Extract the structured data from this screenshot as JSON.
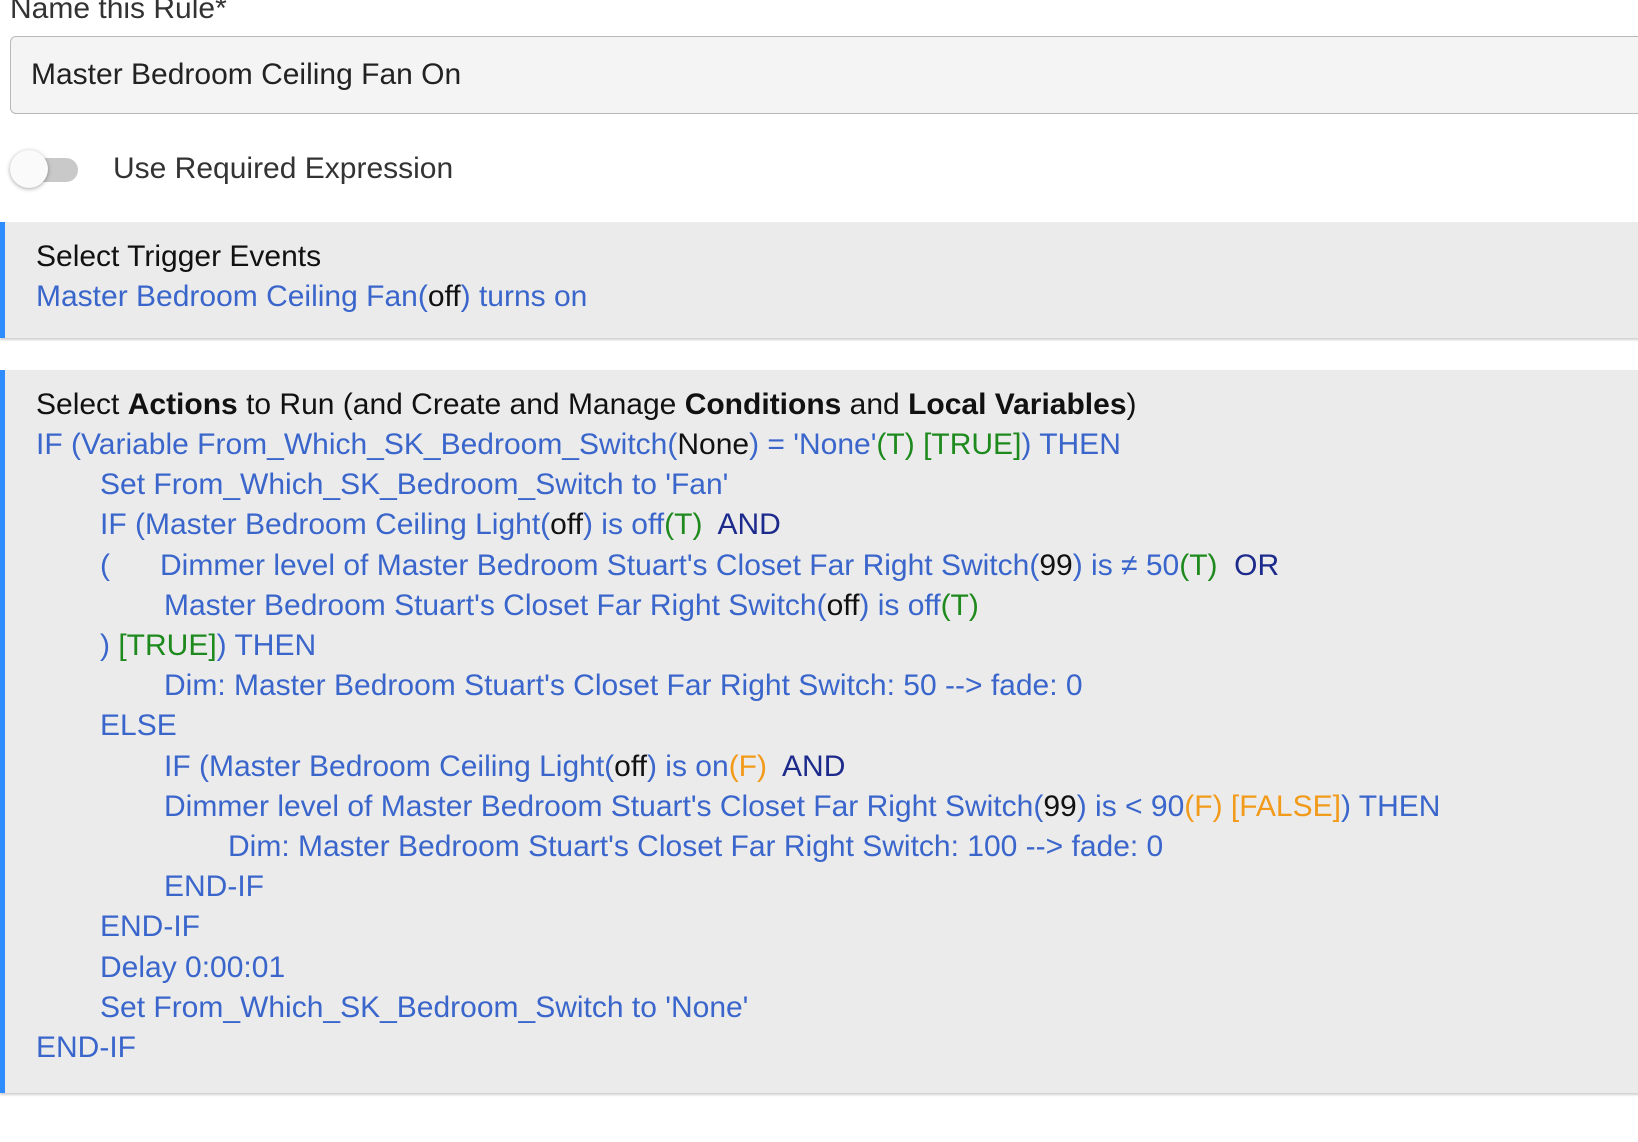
{
  "name_field": {
    "label": "Name this Rule*",
    "value": "Master Bedroom Ceiling Fan On"
  },
  "required_expression": {
    "label": "Use Required Expression",
    "enabled": false
  },
  "trigger": {
    "title": "Select Trigger Events",
    "device": "Master Bedroom Ceiling Fan",
    "paren_open": "(",
    "state": "off",
    "paren_close_text": ") turns on"
  },
  "actions": {
    "title_parts": [
      "Select ",
      "Actions",
      " to Run (and Create and Manage ",
      "Conditions",
      " and ",
      "Local Variables",
      ")"
    ],
    "lines": [
      {
        "indent": 0,
        "segments": [
          {
            "c": "blu",
            "t": "IF (Variable From_Which_SK_Bedroom_Switch("
          },
          {
            "c": "blk",
            "t": "None"
          },
          {
            "c": "blu",
            "t": ") = 'None'"
          },
          {
            "c": "grn",
            "t": "(T) [TRUE]"
          },
          {
            "c": "blu",
            "t": ") THEN"
          }
        ]
      },
      {
        "indent": 1,
        "segments": [
          {
            "c": "blu",
            "t": "Set From_Which_SK_Bedroom_Switch to 'Fan'"
          }
        ]
      },
      {
        "indent": 1,
        "segments": [
          {
            "c": "blu",
            "t": "IF (Master Bedroom Ceiling Light("
          },
          {
            "c": "blk",
            "t": "off"
          },
          {
            "c": "blu",
            "t": ") is off"
          },
          {
            "c": "grn",
            "t": "(T)"
          },
          {
            "c": "nav",
            "t": "  AND"
          }
        ]
      },
      {
        "indent": 1,
        "segments": [
          {
            "c": "blu",
            "t": "(      Dimmer level of Master Bedroom Stuart's Closet Far Right Switch("
          },
          {
            "c": "blk",
            "t": "99"
          },
          {
            "c": "blu",
            "t": ") is ≠ 50"
          },
          {
            "c": "grn",
            "t": "(T)"
          },
          {
            "c": "nav",
            "t": "  OR"
          }
        ]
      },
      {
        "indent": 2,
        "segments": [
          {
            "c": "blu",
            "t": "Master Bedroom Stuart's Closet Far Right Switch("
          },
          {
            "c": "blk",
            "t": "off"
          },
          {
            "c": "blu",
            "t": ") is off"
          },
          {
            "c": "grn",
            "t": "(T)"
          }
        ]
      },
      {
        "indent": 1,
        "segments": [
          {
            "c": "blu",
            "t": ") "
          },
          {
            "c": "grn",
            "t": "[TRUE]"
          },
          {
            "c": "blu",
            "t": ") THEN"
          }
        ]
      },
      {
        "indent": 2,
        "segments": [
          {
            "c": "blu",
            "t": "Dim: Master Bedroom Stuart's Closet Far Right Switch: 50 --> fade: 0"
          }
        ]
      },
      {
        "indent": 1,
        "segments": [
          {
            "c": "blu",
            "t": "ELSE"
          }
        ]
      },
      {
        "indent": 2,
        "segments": [
          {
            "c": "blu",
            "t": "IF (Master Bedroom Ceiling Light("
          },
          {
            "c": "blk",
            "t": "off"
          },
          {
            "c": "blu",
            "t": ") is on"
          },
          {
            "c": "org",
            "t": "(F)"
          },
          {
            "c": "nav",
            "t": "  AND"
          }
        ]
      },
      {
        "indent": 2,
        "segments": [
          {
            "c": "blu",
            "t": "Dimmer level of Master Bedroom Stuart's Closet Far Right Switch("
          },
          {
            "c": "blk",
            "t": "99"
          },
          {
            "c": "blu",
            "t": ") is < 90"
          },
          {
            "c": "org",
            "t": "(F) [FALSE]"
          },
          {
            "c": "blu",
            "t": ") THEN"
          }
        ]
      },
      {
        "indent": 3,
        "segments": [
          {
            "c": "blu",
            "t": "Dim: Master Bedroom Stuart's Closet Far Right Switch: 100 --> fade: 0"
          }
        ]
      },
      {
        "indent": 2,
        "segments": [
          {
            "c": "blu",
            "t": "END-IF"
          }
        ]
      },
      {
        "indent": 1,
        "segments": [
          {
            "c": "blu",
            "t": "END-IF"
          }
        ]
      },
      {
        "indent": 1,
        "segments": [
          {
            "c": "blu",
            "t": "Delay 0:00:01"
          }
        ]
      },
      {
        "indent": 1,
        "segments": [
          {
            "c": "blu",
            "t": "Set From_Which_SK_Bedroom_Switch to 'None'"
          }
        ]
      },
      {
        "indent": 0,
        "segments": [
          {
            "c": "blu",
            "t": "END-IF"
          }
        ]
      }
    ]
  },
  "colors": {
    "link_blue": "#3a66cc",
    "true_green": "#1e8a1e",
    "false_orange": "#f29a1a",
    "operator_navy": "#1c2a8c",
    "accent_border": "#2e8cff"
  }
}
